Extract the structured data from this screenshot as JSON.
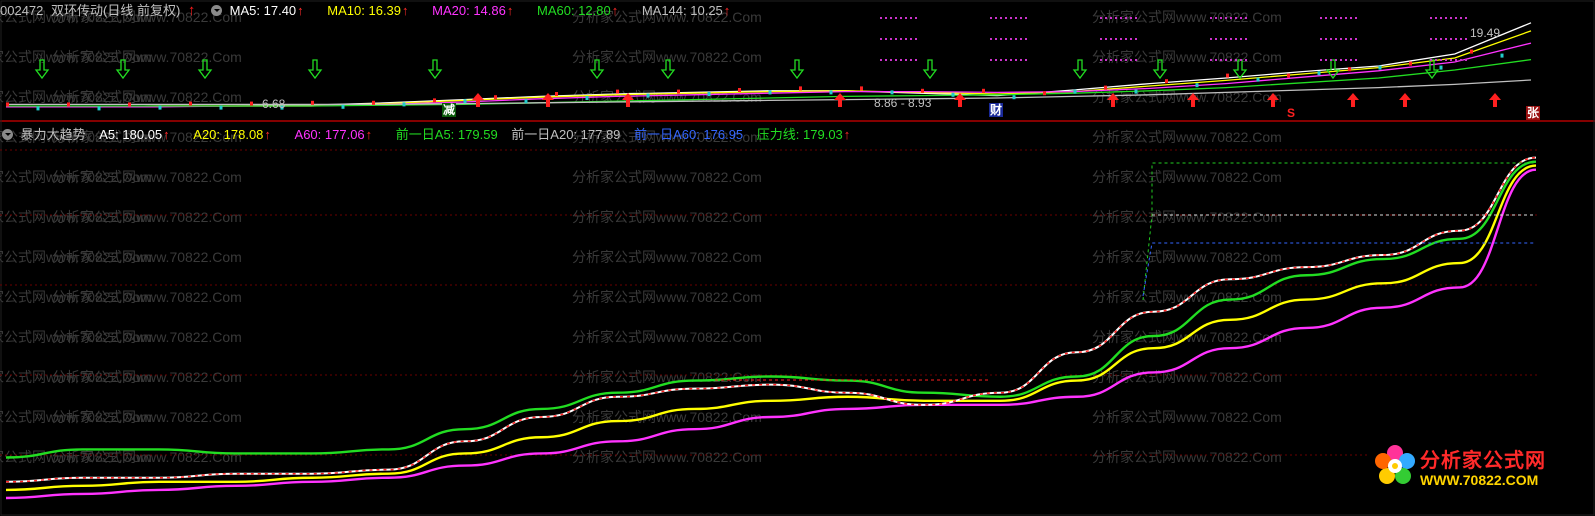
{
  "top_header": {
    "code": "002472",
    "name": "双环传动(日线 前复权)",
    "ma5": "MA5: 17.40",
    "ma10": "MA10: 16.39",
    "ma20": "MA20: 14.86",
    "ma60": "MA60: 12.80",
    "ma144": "MA144: 10.25",
    "up_arrow": "↑"
  },
  "bottom_header": {
    "name": "暴力大趋势",
    "a5": "A5: 180.05",
    "a20": "A20: 178.08",
    "a60": "A60: 177.06",
    "prev_a5": "前一日A5: 179.59",
    "prev_a20": "前一日A20: 177.89",
    "prev_a60": "前一日A60: 176.95",
    "pressure": "压力线: 179.03",
    "up_arrow": "↑"
  },
  "top_panel_text": {
    "low_price": "6.68",
    "range_label": "8.86 - 8.93",
    "high_price": "19.49",
    "marker_jian": "减",
    "marker_cai": "财",
    "marker_s": "S",
    "marker_zhang": "张"
  },
  "watermark": {
    "text": "分析家公式网www.70822.Com"
  },
  "logo": {
    "title": "分析家公式网",
    "url": "WWW.70822.COM"
  },
  "colors": {
    "background": "#000000",
    "white": "#ffffff",
    "yellow": "#ffff00",
    "magenta": "#ff33ff",
    "green": "#22dd22",
    "red": "#ff2020",
    "grey": "#c0c0c0",
    "blue": "#3366ff"
  },
  "chart_data": [
    {
      "type": "line",
      "panel": "price candlestick with moving averages",
      "x": [
        0,
        5,
        10,
        15,
        20,
        25,
        30,
        35,
        40,
        45,
        50,
        55,
        60,
        65,
        70,
        75,
        80,
        85,
        90,
        95,
        100
      ],
      "series": [
        {
          "name": "MA5",
          "color": "#ffffff",
          "values": [
            6.9,
            6.9,
            7.0,
            7.0,
            7.1,
            7.4,
            7.8,
            8.2,
            8.5,
            8.7,
            8.9,
            8.9,
            8.6,
            8.3,
            9.0,
            9.8,
            10.5,
            11.3,
            12.0,
            13.5,
            17.4
          ]
        },
        {
          "name": "MA10",
          "color": "#ffff00",
          "values": [
            6.9,
            6.9,
            7.0,
            7.0,
            7.0,
            7.3,
            7.7,
            8.1,
            8.4,
            8.6,
            8.8,
            8.9,
            8.7,
            8.5,
            8.8,
            9.5,
            10.2,
            11.0,
            11.8,
            13.0,
            16.39
          ]
        },
        {
          "name": "MA20",
          "color": "#ff33ff",
          "values": [
            6.9,
            6.9,
            6.9,
            7.0,
            7.0,
            7.2,
            7.5,
            7.9,
            8.2,
            8.4,
            8.6,
            8.8,
            8.8,
            8.7,
            8.8,
            9.2,
            9.8,
            10.6,
            11.4,
            12.5,
            14.86
          ]
        },
        {
          "name": "MA60",
          "color": "#22dd22",
          "values": [
            7.0,
            7.0,
            7.0,
            7.0,
            7.0,
            7.1,
            7.2,
            7.4,
            7.6,
            7.8,
            8.0,
            8.2,
            8.3,
            8.4,
            8.6,
            8.9,
            9.3,
            9.9,
            10.5,
            11.5,
            12.8
          ]
        },
        {
          "name": "MA144",
          "color": "#c0c0c0",
          "values": [
            7.2,
            7.2,
            7.2,
            7.2,
            7.2,
            7.2,
            7.3,
            7.4,
            7.5,
            7.6,
            7.7,
            7.8,
            7.9,
            8.0,
            8.2,
            8.4,
            8.7,
            9.0,
            9.3,
            9.7,
            10.25
          ]
        }
      ],
      "annotations": [
        "6.68",
        "8.86 - 8.93",
        "19.49"
      ]
    },
    {
      "type": "line",
      "panel": "暴力大趋势 indicator",
      "x": [
        0,
        5,
        10,
        15,
        20,
        25,
        30,
        35,
        40,
        45,
        50,
        55,
        60,
        65,
        70,
        75,
        80,
        85,
        90,
        95,
        100
      ],
      "series": [
        {
          "name": "A5",
          "color": "#ffffff",
          "values": [
            100,
            101,
            101,
            102,
            102,
            103,
            110,
            116,
            121,
            123,
            124,
            122,
            119,
            122,
            132,
            142,
            150,
            153,
            156,
            162,
            180.05
          ]
        },
        {
          "name": "A20",
          "color": "#ffff00",
          "values": [
            98,
            99,
            100,
            100,
            101,
            102,
            107,
            111,
            115,
            118,
            120,
            121,
            120,
            120,
            125,
            133,
            140,
            145,
            149,
            154,
            178.08
          ]
        },
        {
          "name": "A60",
          "color": "#ff33ff",
          "values": [
            96,
            97,
            98,
            99,
            100,
            101,
            104,
            107,
            110,
            113,
            116,
            118,
            119,
            119,
            121,
            127,
            133,
            138,
            143,
            148,
            177.06
          ]
        },
        {
          "name": "压力线",
          "color": "#22dd22",
          "values": [
            106,
            108,
            108,
            107,
            107,
            108,
            113,
            118,
            122,
            125,
            126,
            125,
            122,
            121,
            126,
            136,
            145,
            151,
            155,
            160,
            179.03
          ]
        }
      ],
      "grid": true
    }
  ]
}
